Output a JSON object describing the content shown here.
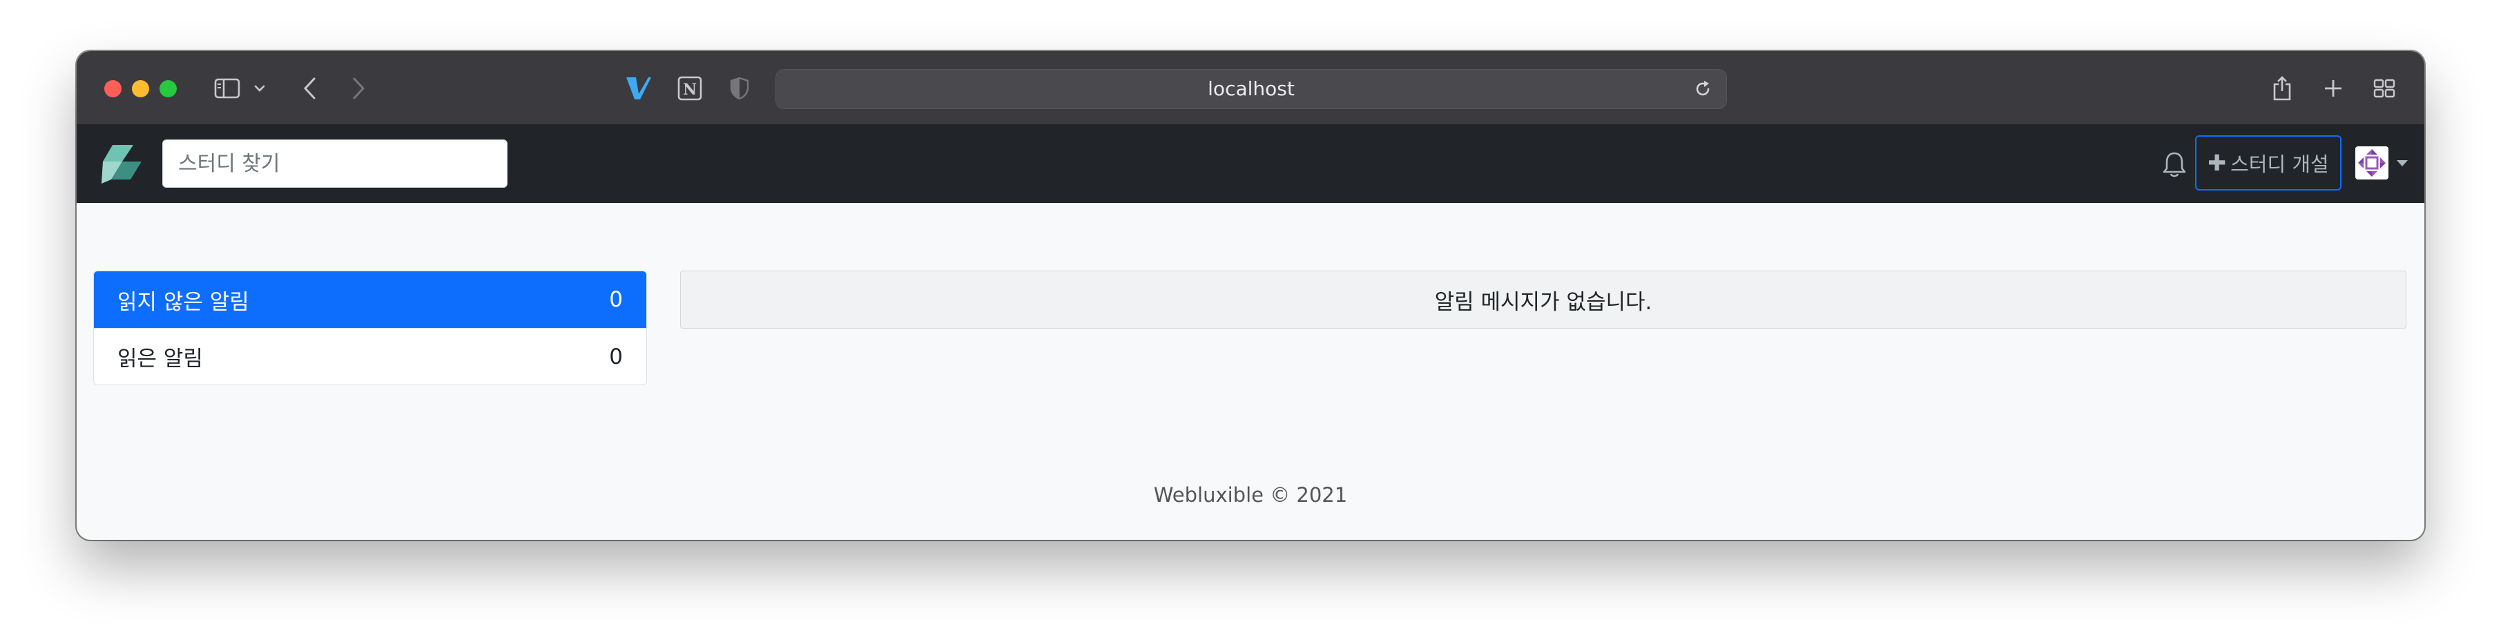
{
  "browser": {
    "url": "localhost"
  },
  "navbar": {
    "search_placeholder": "스터디 찾기",
    "create_study_label": "스터디 개설",
    "colors": {
      "background": "#212529",
      "primary": "#0d6efd"
    }
  },
  "notifications": {
    "tabs": [
      {
        "label": "읽지 않은 알림",
        "count": "0",
        "active": true
      },
      {
        "label": "읽은 알림",
        "count": "0",
        "active": false
      }
    ],
    "empty_message": "알림 메시지가 없습니다."
  },
  "footer": {
    "text": "Webluxible © 2021"
  },
  "icons": [
    "sidebar-icon",
    "chevron-down-icon",
    "back-icon",
    "forward-icon",
    "vue-devtools-icon",
    "notion-icon",
    "shield-icon",
    "reload-icon",
    "share-icon",
    "plus-icon",
    "tabs-overview-icon",
    "logo-icon",
    "bell-icon",
    "avatar"
  ]
}
